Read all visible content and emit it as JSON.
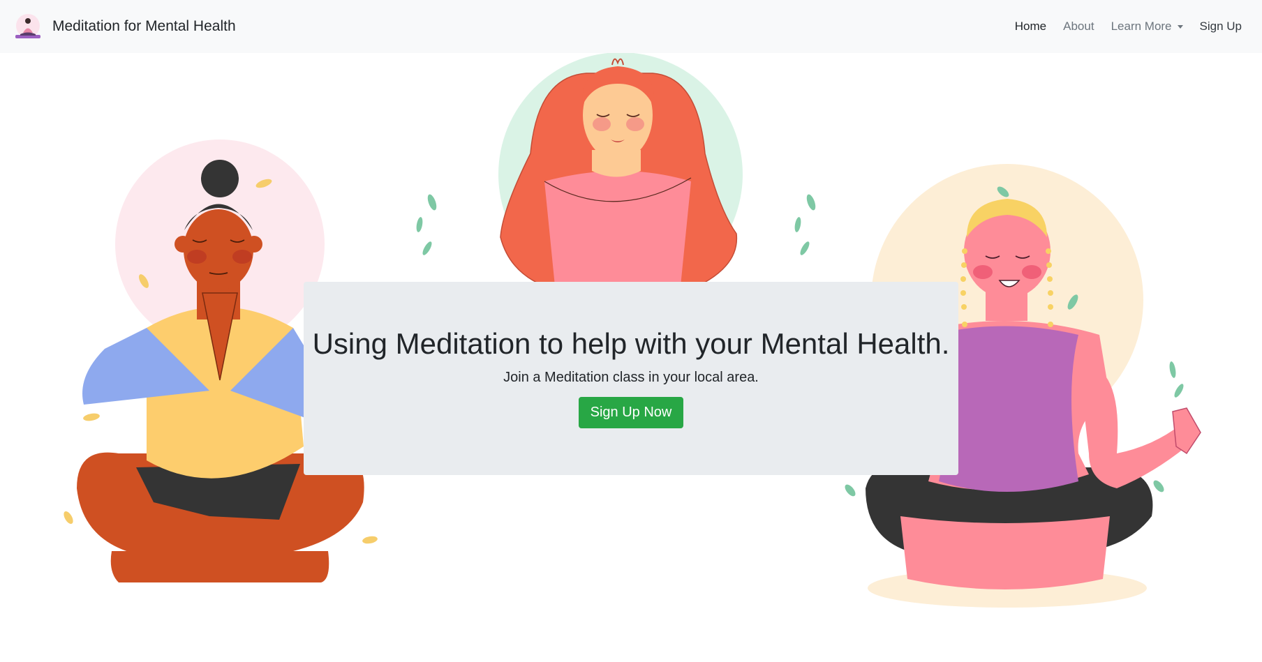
{
  "navbar": {
    "brand_text": "Meditation for Mental Health",
    "links": {
      "home": "Home",
      "about": "About",
      "learn_more": "Learn More",
      "sign_up": "Sign Up"
    }
  },
  "hero": {
    "heading": "Using Meditation to help with your Mental Health.",
    "subheading": "Join a Meditation class in your local area.",
    "cta_label": "Sign Up Now"
  },
  "colors": {
    "navbar_bg": "#f8f9fa",
    "jumbotron_bg": "#e9ecef",
    "cta_green": "#28a745",
    "circle_pink": "#fde9ee",
    "circle_mint": "#daf3e6",
    "circle_cream": "#fdeed6"
  },
  "icons": {
    "brand_logo": "meditation-logo-icon",
    "dropdown_caret": "chevron-down-icon"
  }
}
